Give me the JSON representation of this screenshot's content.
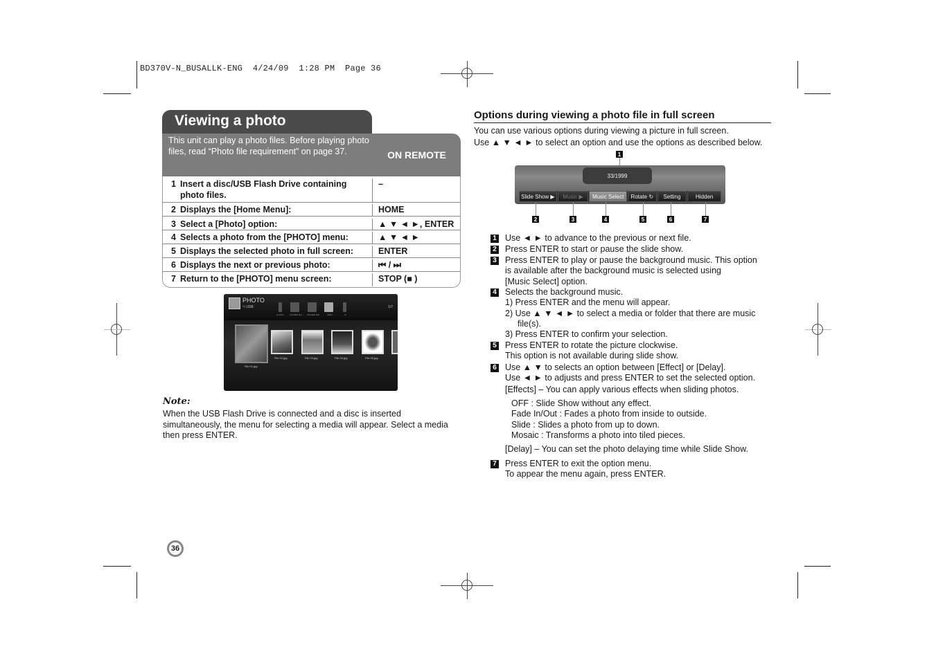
{
  "slug": "BD370V-N_BUSALLK-ENG  4/24/09  1:28 PM  Page 36",
  "left": {
    "title": "Viewing a photo",
    "intro": "This unit can play a photo files. Before playing photo files, read “Photo file requirement” on page 37.",
    "remote_header": "ON REMOTE",
    "steps": [
      {
        "num": "1",
        "desc": "Insert a disc/USB Flash Drive containing photo files.",
        "key": "–"
      },
      {
        "num": "2",
        "desc": "Displays the [Home Menu]:",
        "key": "HOME"
      },
      {
        "num": "3",
        "desc": "Select a [Photo] option:",
        "key": "▲ ▼ ◄ ►, ENTER"
      },
      {
        "num": "4",
        "desc": "Selects a photo from the [PHOTO] menu:",
        "key": "▲ ▼ ◄ ►"
      },
      {
        "num": "5",
        "desc": "Displays the selected photo in full screen:",
        "key": "ENTER"
      },
      {
        "num": "6",
        "desc": "Displays the next or previous photo:",
        "key": "⏮ / ⏭"
      },
      {
        "num": "7",
        "desc": "Return to the [PHOTO] menu screen:",
        "key": "STOP (■ )"
      }
    ],
    "photo_menu": {
      "title": "PHOTO",
      "source": "⮌ USB",
      "count": "1/7",
      "folders": [
        "CLOUD",
        "FOLDER 001",
        "FOLDER 002",
        "JPEG",
        "M"
      ],
      "files": [
        "File 01.jpg",
        "File 02.jpg",
        "File 03.jpg",
        "File 04.jpg",
        "File 05.jpg"
      ]
    },
    "note_heading": "Note:",
    "note_text": "When the USB Flash Drive is connected and a disc is inserted simultaneously, the menu for selecting a media will appear. Select a media then press ENTER."
  },
  "page_number": "36",
  "right": {
    "title": "Options during viewing a photo file in full screen",
    "intro_lines": [
      "You can use various options during viewing a picture in full screen.",
      "Use ▲ ▼ ◄ ► to select an option and use the options as described below."
    ],
    "osd": {
      "counter": "33/1999",
      "buttons": [
        "Slide Show ▶",
        "Music ▶",
        "Music Select",
        "Rotate ↻",
        "Setting",
        "Hidden"
      ],
      "callouts": [
        "1",
        "2",
        "3",
        "4",
        "5",
        "6",
        "7"
      ]
    },
    "items": [
      {
        "badge": "1",
        "lines": [
          "Use ◄ ► to advance to the previous or next file."
        ]
      },
      {
        "badge": "2",
        "lines": [
          "Press ENTER to start or pause the slide show."
        ]
      },
      {
        "badge": "3",
        "lines": [
          "Press ENTER to play or pause the background music. This option",
          "is available after the background music is selected using",
          "[Music Select] option."
        ]
      },
      {
        "badge": "4",
        "lines": [
          "Selects the background music.",
          "1)  Press ENTER and the menu will appear.",
          "2)  Use ▲ ▼ ◄ ► to select a media or folder that there are music",
          "file(s).",
          "3)  Press ENTER to confirm your selection."
        ]
      },
      {
        "badge": "5",
        "lines": [
          "Press ENTER to rotate the picture clockwise.",
          "This option is not available during slide show."
        ]
      },
      {
        "badge": "6",
        "lines": [
          "Use ▲ ▼ to selects an option between [Effect] or [Delay].",
          "Use ◄ ► to adjusts and press ENTER to set the selected option.",
          "[Effects] – You can apply various effects when sliding photos.",
          "OFF : Slide Show without any effect.",
          "Fade In/Out : Fades a photo from inside to outside.",
          "Slide : Slides a photo from up to down.",
          "Mosaic : Transforms a photo into tiled pieces.",
          "[Delay] – You can set the photo delaying time while Slide Show."
        ]
      },
      {
        "badge": "7",
        "lines": [
          "Press ENTER to exit the option menu.",
          "To appear the menu again, press ENTER."
        ]
      }
    ]
  }
}
